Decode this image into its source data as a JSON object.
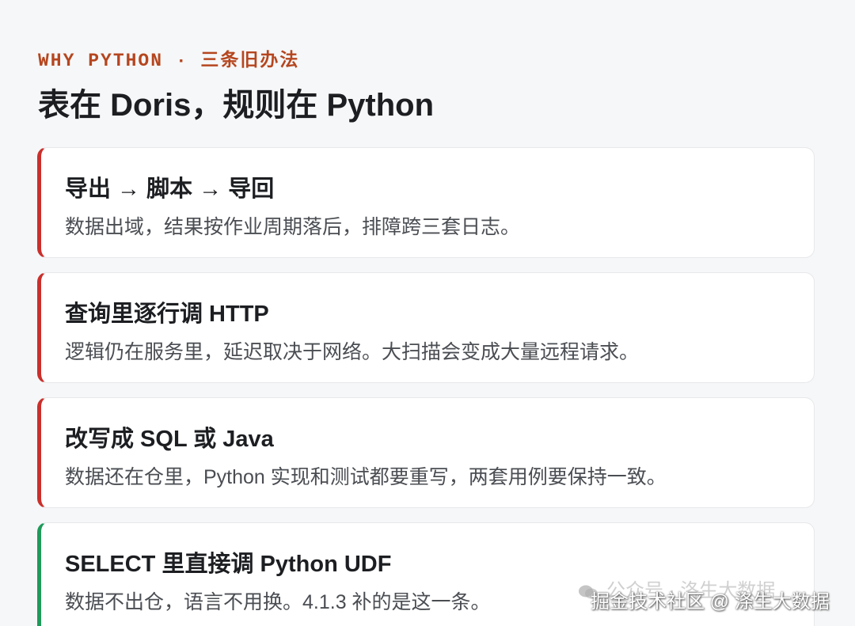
{
  "header": {
    "eyebrow": "WHY PYTHON · 三条旧办法",
    "title": "表在 Doris，规则在 Python"
  },
  "cards": [
    {
      "title": "导出 → 脚本 → 导回",
      "desc": "数据出域，结果按作业周期落后，排障跨三套日志。",
      "status": "bad"
    },
    {
      "title": "查询里逐行调 HTTP",
      "desc": "逻辑仍在服务里，延迟取决于网络。大扫描会变成大量远程请求。",
      "status": "bad"
    },
    {
      "title": "改写成 SQL 或 Java",
      "desc": "数据还在仓里，Python 实现和测试都要重写，两套用例要保持一致。",
      "status": "bad"
    },
    {
      "title": "SELECT 里直接调 Python UDF",
      "desc": "数据不出仓，语言不用换。4.1.3 补的是这一条。",
      "status": "good"
    }
  ],
  "watermark": {
    "wechat_text": "公众号 · 洛生大数据",
    "juejin_text": "掘金技术社区 @ 涤生大数据",
    "icon": "wechat-icon"
  },
  "colors": {
    "accent": "#b5461f",
    "bad": "#c9302c",
    "good": "#1e9a5a"
  }
}
